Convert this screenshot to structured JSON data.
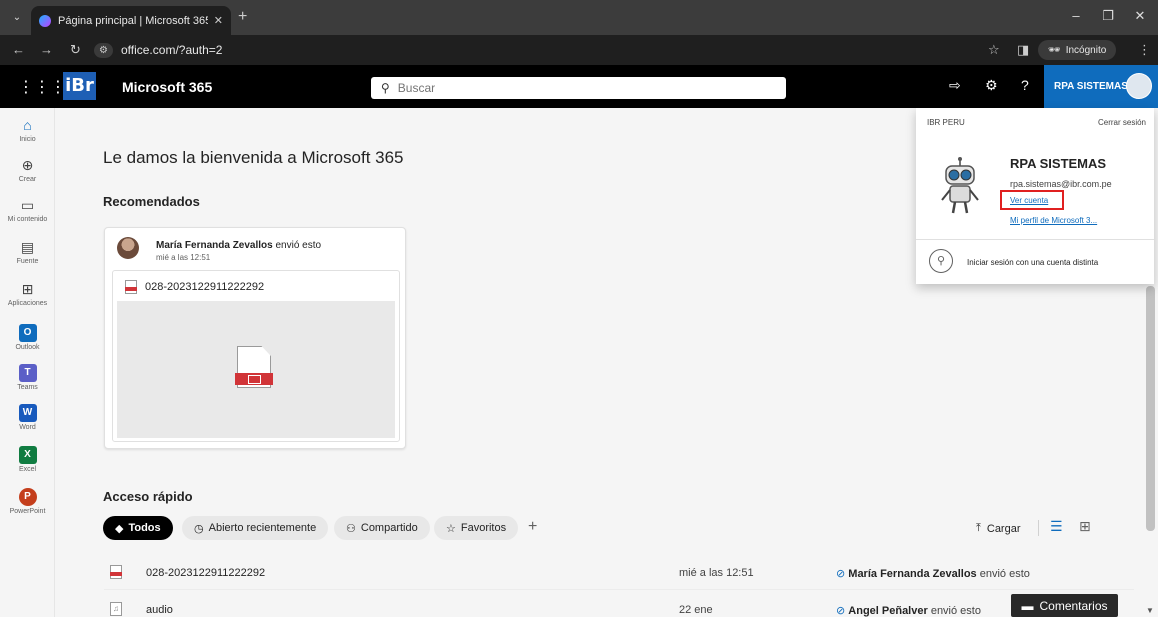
{
  "browser": {
    "tab_title": "Página principal | Microsoft 365",
    "tab_close": "✕",
    "new_tab": "+",
    "url": "office.com/?auth=2",
    "incognito_label": "Incógnito"
  },
  "header": {
    "logo_text": "iBr",
    "app_name": "Microsoft 365",
    "search_placeholder": "Buscar",
    "help": "?",
    "account_name": "RPA SISTEMAS"
  },
  "rail": {
    "items": [
      {
        "label": "Inicio",
        "icon": "home-icon"
      },
      {
        "label": "Crear",
        "icon": "create-icon"
      },
      {
        "label": "Mi contenido",
        "icon": "folder-icon"
      },
      {
        "label": "Fuente",
        "icon": "feed-icon"
      },
      {
        "label": "Aplicaciones",
        "icon": "apps-icon"
      },
      {
        "label": "Outlook",
        "icon": "outlook-icon",
        "letter": "O",
        "color": "#0f6cbd"
      },
      {
        "label": "Teams",
        "icon": "teams-icon",
        "letter": "T",
        "color": "#5b5fc7"
      },
      {
        "label": "Word",
        "icon": "word-icon",
        "letter": "W",
        "color": "#185abd"
      },
      {
        "label": "Excel",
        "icon": "excel-icon",
        "letter": "X",
        "color": "#107c41"
      },
      {
        "label": "PowerPoint",
        "icon": "powerpoint-icon",
        "letter": "P",
        "color": "#c43e1c"
      }
    ]
  },
  "main": {
    "welcome": "Le damos la bienvenida a Microsoft 365",
    "recommended_title": "Recomendados",
    "recommended_card": {
      "sender": "María Fernanda Zevallos",
      "action": " envió esto",
      "when": "mié a las 12:51",
      "file_name": "028-2023122911222292"
    },
    "quick_access_title": "Acceso rápido",
    "filters": [
      "Todos",
      "Abierto recientemente",
      "Compartido",
      "Favoritos"
    ],
    "upload_label": "Cargar",
    "files": [
      {
        "name": "028-2023122911222292",
        "date": "mié a las 12:51",
        "actor": "María Fernanda Zevallos",
        "activity": " envió esto",
        "type": "pdf"
      },
      {
        "name": "audio",
        "date": "22 ene",
        "actor": "Angel Peñalver",
        "activity": " envió esto",
        "type": "audio"
      }
    ],
    "feedback_label": "Comentarios"
  },
  "flyout": {
    "org": "IBR PERU",
    "sign_out": "Cerrar sesión",
    "name": "RPA SISTEMAS",
    "email": "rpa.sistemas@ibr.com.pe",
    "view_account": "Ver cuenta",
    "profile_link": "Mi perfil de Microsoft 3...",
    "other_account": "Iniciar sesión con una cuenta distinta"
  },
  "colors": {
    "accent": "#0f6cbd",
    "highlight": "#e02020",
    "header_bg": "#000000"
  }
}
